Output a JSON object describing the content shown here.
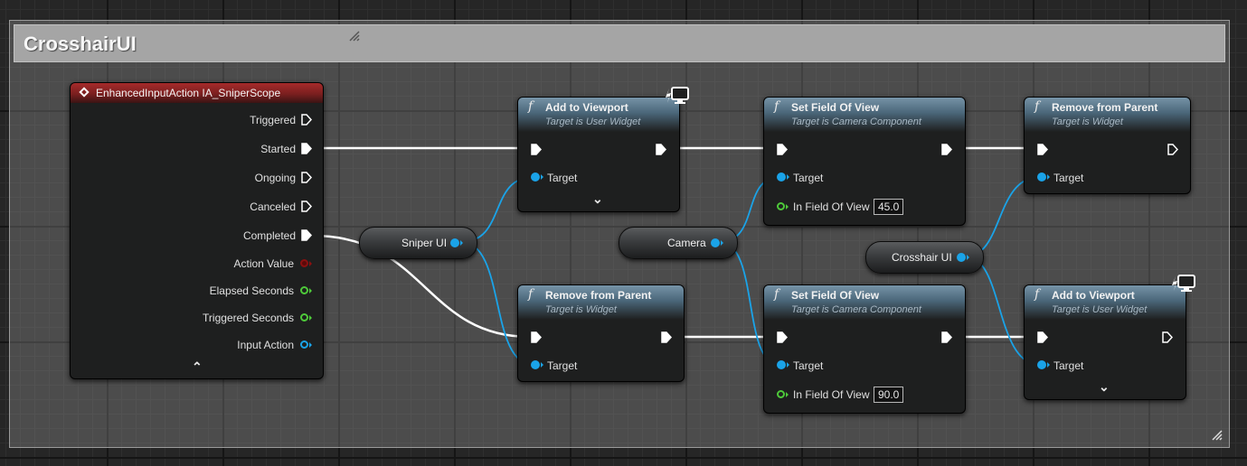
{
  "comment": {
    "title": "CrosshairUI"
  },
  "event_node": {
    "title": "EnhancedInputAction IA_SniperScope",
    "pins": [
      "Triggered",
      "Started",
      "Ongoing",
      "Canceled",
      "Completed",
      "Action Value",
      "Elapsed Seconds",
      "Triggered Seconds",
      "Input Action"
    ]
  },
  "variables": {
    "sniper_ui": "Sniper UI",
    "camera": "Camera",
    "crosshair_ui": "Crosshair UI"
  },
  "nodes": {
    "add_viewport_1": {
      "title": "Add to Viewport",
      "subtitle": "Target is User Widget",
      "pin": "Target"
    },
    "remove_parent_1": {
      "title": "Remove from Parent",
      "subtitle": "Target is Widget",
      "pin": "Target"
    },
    "set_fov_1": {
      "title": "Set Field Of View",
      "subtitle": "Target is Camera Component",
      "pin_target": "Target",
      "pin_fov": "In Field Of View",
      "fov_value": "45.0"
    },
    "set_fov_2": {
      "title": "Set Field Of View",
      "subtitle": "Target is Camera Component",
      "pin_target": "Target",
      "pin_fov": "In Field Of View",
      "fov_value": "90.0"
    },
    "remove_parent_2": {
      "title": "Remove from Parent",
      "subtitle": "Target is Widget",
      "pin": "Target"
    },
    "add_viewport_2": {
      "title": "Add to Viewport",
      "subtitle": "Target is User Widget",
      "pin": "Target"
    }
  },
  "icons": {
    "function": "f",
    "expand": "chevron-down-icon",
    "collapse": "chevron-up-icon",
    "client_only": "monitor-icon"
  },
  "colors": {
    "exec_wire": "#ffffff",
    "object_pin": "#1aa3e8",
    "float_pin": "#4ec93a",
    "struct_pin": "#8a1010",
    "event_header": "#a62b2b",
    "function_header": "#4a6679"
  }
}
